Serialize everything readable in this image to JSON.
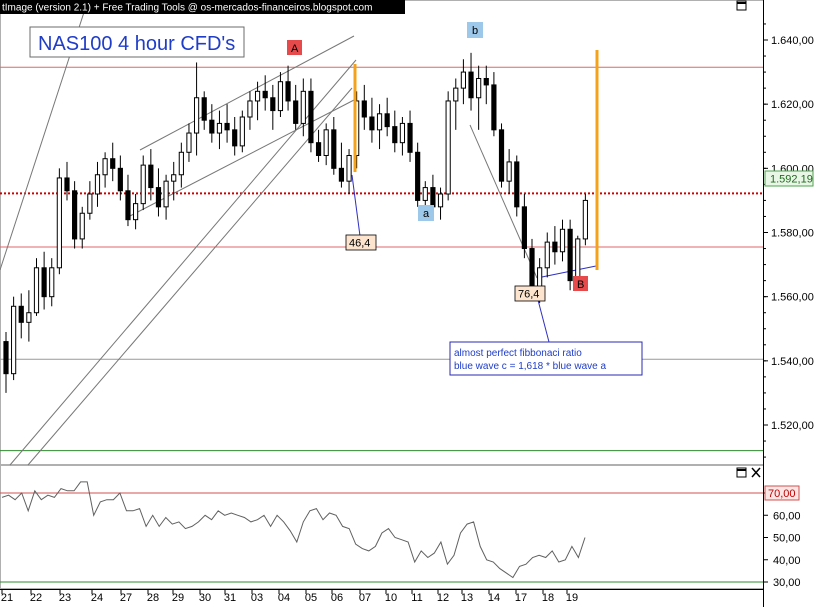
{
  "app": {
    "title_bar": "tImage (version 2.1) + Free Trading Tools @ os-mercados-financeiros.blogspot.com"
  },
  "chart_data": [
    {
      "type": "candlestick",
      "title": "NAS100 4 hour CFD's",
      "x_ticks": [
        "21",
        "22",
        "23",
        "24",
        "27",
        "28",
        "29",
        "30",
        "31",
        "03",
        "04",
        "05",
        "06",
        "07",
        "10",
        "11",
        "12",
        "13",
        "14",
        "17",
        "18",
        "19"
      ],
      "y_ticks": [
        "1.640,00",
        "1.620,00",
        "1.600,00",
        "1.580,00",
        "1.560,00",
        "1.540,00",
        "1.520,00"
      ],
      "ylim": [
        1505,
        1646
      ],
      "last_price": 1592.19,
      "last_price_label": "1.592,19",
      "horizontal_levels": [
        {
          "value": 1631.5,
          "color": "#e06666",
          "style": "solid"
        },
        {
          "value": 1592.19,
          "color": "#d00000",
          "style": "dotted"
        },
        {
          "value": 1575.5,
          "color": "#e06666",
          "style": "solid"
        },
        {
          "value": 1540.5,
          "color": "#999999",
          "style": "solid"
        },
        {
          "value": 1512.0,
          "color": "#2e8b2e",
          "style": "solid"
        }
      ],
      "candles": [
        [
          1546,
          1549,
          1530,
          1536
        ],
        [
          1536,
          1560,
          1534,
          1557
        ],
        [
          1557,
          1561,
          1547,
          1552
        ],
        [
          1552,
          1562,
          1546,
          1555
        ],
        [
          1555,
          1572,
          1554,
          1569
        ],
        [
          1569,
          1574,
          1556,
          1560
        ],
        [
          1560,
          1572,
          1557,
          1569
        ],
        [
          1569,
          1600,
          1567,
          1597
        ],
        [
          1597,
          1602,
          1590,
          1593
        ],
        [
          1593,
          1596,
          1575,
          1578
        ],
        [
          1578,
          1588,
          1575,
          1586
        ],
        [
          1586,
          1596,
          1584,
          1592
        ],
        [
          1592,
          1602,
          1588,
          1598
        ],
        [
          1598,
          1605,
          1594,
          1603
        ],
        [
          1603,
          1608,
          1596,
          1600
        ],
        [
          1600,
          1604,
          1590,
          1593
        ],
        [
          1593,
          1598,
          1582,
          1584
        ],
        [
          1584,
          1592,
          1581,
          1589
        ],
        [
          1589,
          1604,
          1587,
          1601
        ],
        [
          1601,
          1606,
          1590,
          1594
        ],
        [
          1594,
          1600,
          1585,
          1588
        ],
        [
          1588,
          1598,
          1584,
          1596
        ],
        [
          1596,
          1602,
          1590,
          1598
        ],
        [
          1598,
          1608,
          1594,
          1605
        ],
        [
          1605,
          1614,
          1602,
          1611
        ],
        [
          1611,
          1633,
          1604,
          1622
        ],
        [
          1622,
          1624,
          1612,
          1615
        ],
        [
          1615,
          1620,
          1608,
          1611
        ],
        [
          1611,
          1618,
          1606,
          1614
        ],
        [
          1614,
          1620,
          1608,
          1612
        ],
        [
          1612,
          1616,
          1604,
          1607
        ],
        [
          1607,
          1618,
          1605,
          1616
        ],
        [
          1616,
          1624,
          1612,
          1621
        ],
        [
          1621,
          1627,
          1615,
          1624
        ],
        [
          1624,
          1629,
          1618,
          1622
        ],
        [
          1622,
          1626,
          1612,
          1618
        ],
        [
          1618,
          1630,
          1616,
          1627
        ],
        [
          1627,
          1632,
          1618,
          1621
        ],
        [
          1621,
          1626,
          1612,
          1614
        ],
        [
          1614,
          1628,
          1610,
          1624
        ],
        [
          1624,
          1628,
          1605,
          1608
        ],
        [
          1608,
          1612,
          1602,
          1604
        ],
        [
          1604,
          1614,
          1601,
          1612
        ],
        [
          1612,
          1616,
          1598,
          1600
        ],
        [
          1600,
          1608,
          1594,
          1596
        ],
        [
          1596,
          1606,
          1592,
          1604
        ],
        [
          1604,
          1624,
          1600,
          1621
        ],
        [
          1621,
          1626,
          1612,
          1616
        ],
        [
          1616,
          1622,
          1608,
          1612
        ],
        [
          1612,
          1620,
          1606,
          1617
        ],
        [
          1617,
          1622,
          1610,
          1613
        ],
        [
          1613,
          1618,
          1605,
          1608
        ],
        [
          1608,
          1616,
          1604,
          1614
        ],
        [
          1614,
          1618,
          1602,
          1605
        ],
        [
          1605,
          1608,
          1588,
          1590
        ],
        [
          1590,
          1596,
          1586,
          1594
        ],
        [
          1594,
          1598,
          1585,
          1588
        ],
        [
          1588,
          1594,
          1584,
          1592
        ],
        [
          1592,
          1624,
          1590,
          1621
        ],
        [
          1621,
          1628,
          1612,
          1625
        ],
        [
          1625,
          1634,
          1620,
          1630
        ],
        [
          1630,
          1636,
          1618,
          1622
        ],
        [
          1622,
          1632,
          1612,
          1628
        ],
        [
          1628,
          1632,
          1620,
          1626
        ],
        [
          1626,
          1630,
          1610,
          1612
        ],
        [
          1612,
          1614,
          1594,
          1596
        ],
        [
          1596,
          1606,
          1592,
          1602
        ],
        [
          1602,
          1604,
          1585,
          1588
        ],
        [
          1588,
          1592,
          1572,
          1575
        ],
        [
          1575,
          1578,
          1560,
          1563
        ],
        [
          1563,
          1572,
          1558,
          1569
        ],
        [
          1569,
          1580,
          1566,
          1577
        ],
        [
          1577,
          1582,
          1570,
          1574
        ],
        [
          1574,
          1584,
          1571,
          1581
        ],
        [
          1581,
          1584,
          1562,
          1565
        ],
        [
          1565,
          1579,
          1563,
          1578
        ],
        [
          1578,
          1592,
          1576,
          1590
        ]
      ],
      "rsi_ticks": [
        "70,00",
        "60,00",
        "50,00",
        "40,00",
        "30,00"
      ],
      "rsi_ylim": [
        28,
        80
      ],
      "rsi_levels": [
        70,
        30
      ],
      "rsi_values": [
        68,
        69,
        67,
        70,
        62,
        71,
        67,
        69,
        68,
        72,
        71,
        71,
        75,
        75,
        60,
        66,
        67,
        67,
        70,
        62,
        62,
        63,
        55,
        60,
        55,
        59,
        56,
        57,
        54,
        55,
        57,
        60,
        58,
        62,
        60,
        61,
        60,
        59,
        57,
        58,
        60,
        55,
        60,
        57,
        53,
        48,
        57,
        62,
        63,
        58,
        61,
        60,
        55,
        54,
        47,
        45,
        44,
        46,
        52,
        54,
        50,
        49,
        48,
        39,
        44,
        41,
        43,
        48,
        38,
        42,
        52,
        56,
        57,
        46,
        40,
        39,
        36,
        34,
        32,
        37,
        38,
        41,
        42,
        41,
        44,
        39,
        40,
        46,
        41,
        50
      ],
      "annotations": {
        "label_A": "A",
        "label_b": "b",
        "label_a": "a",
        "label_B": "B",
        "retrace_1": "46,4",
        "retrace_2": "76,4",
        "fib_note_line1": "almost perfect fibbonaci ratio",
        "fib_note_line2": "blue wave c = 1,618 * blue wave a"
      }
    }
  ],
  "colors": {
    "candle": "#000000",
    "up_fill": "#ffffff",
    "down_fill": "#000000",
    "orange_bar": "#f4a21b",
    "title_color": "#1f3dc8",
    "label_red": "#e64a4a",
    "label_blue": "#9ec8ea",
    "fib_box_text": "#1f3dc8"
  },
  "icons": {
    "top_pane_max": "square-icon",
    "bottom_pane_max": "square-icon",
    "bottom_pane_close": "close-icon"
  }
}
